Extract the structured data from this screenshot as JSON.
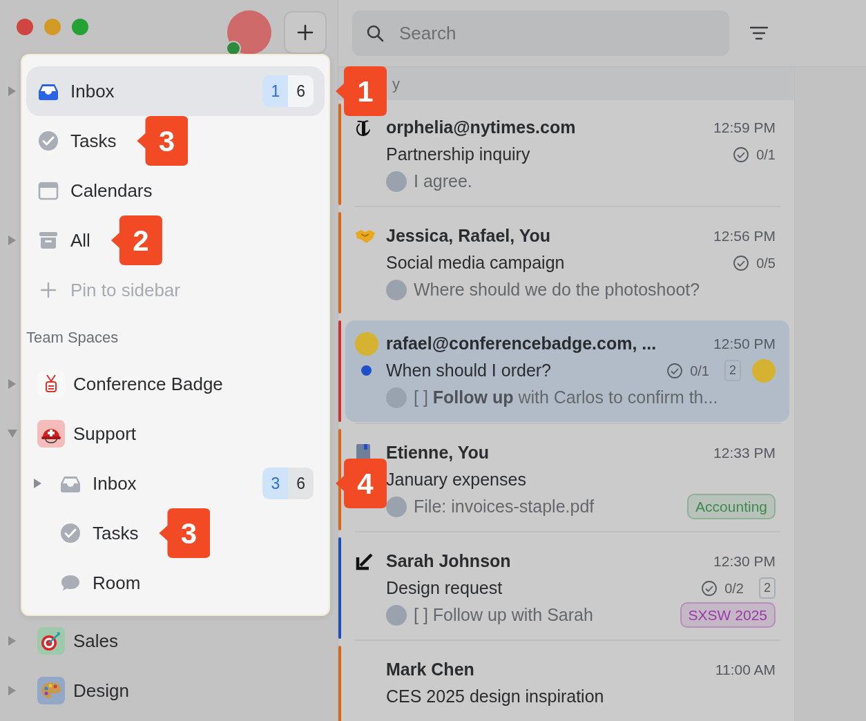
{
  "sidebar": {
    "pinned": [
      {
        "label": "Inbox",
        "kind": "inbox",
        "has_children": true,
        "expanded": false,
        "selected": true,
        "unread": "1",
        "total": "6",
        "callout": "1"
      },
      {
        "label": "Tasks",
        "kind": "tasks",
        "has_children": false,
        "selected": false,
        "callout": "3"
      },
      {
        "label": "Calendars",
        "kind": "calendar",
        "has_children": false,
        "selected": false
      },
      {
        "label": "All",
        "kind": "archive",
        "has_children": true,
        "expanded": false,
        "selected": false,
        "callout": "2"
      }
    ],
    "pin_action": "Pin to sidebar",
    "section_title": "Team Spaces",
    "spaces": [
      {
        "label": "Conference Badge",
        "kind": "badge",
        "has_children": true,
        "expanded": false,
        "spotlit": true
      },
      {
        "label": "Support",
        "kind": "helmet",
        "has_children": true,
        "expanded": true,
        "spotlit": true,
        "children": [
          {
            "label": "Inbox",
            "kind": "inbox",
            "has_children": true,
            "expanded": false,
            "unread": "3",
            "total": "6",
            "callout": "4"
          },
          {
            "label": "Tasks",
            "kind": "tasks",
            "has_children": false,
            "callout": "3"
          },
          {
            "label": "Room",
            "kind": "room",
            "has_children": false
          }
        ]
      },
      {
        "label": "Sales",
        "kind": "target",
        "has_children": true,
        "expanded": false,
        "spotlit": false
      },
      {
        "label": "Design",
        "kind": "palette",
        "has_children": true,
        "expanded": false,
        "spotlit": false
      }
    ]
  },
  "search": {
    "placeholder": "Search"
  },
  "list": {
    "section_header": "y",
    "messages": [
      {
        "color": "#d8671e",
        "kind": "newspaper",
        "sender": "orphelia@nytimes.com",
        "time": "12:59 PM",
        "unread": false,
        "selected": false,
        "subject": "Partnership inquiry",
        "tasks": "0/1",
        "preview": "I agree."
      },
      {
        "color": "#d8671e",
        "kind": "handshake",
        "sender": "Jessica, Rafael, You",
        "time": "12:56 PM",
        "unread": false,
        "selected": false,
        "subject": "Social media campaign",
        "tasks": "0/5",
        "preview": "Where should we do the photoshoot?"
      },
      {
        "color": "#c8332d",
        "kind": "person",
        "sender": "rafael@conferencebadge.com, ...",
        "time": "12:50 PM",
        "unread": true,
        "selected": true,
        "subject": "When should I order?",
        "tasks": "0/1",
        "count": "2",
        "preview": "[ ] **Follow up** with Carlos to confirm th..."
      },
      {
        "color": "#d8671e",
        "kind": "document",
        "sender": "Etienne, You",
        "time": "12:33 PM",
        "unread": false,
        "selected": false,
        "subject": "January expenses",
        "preview": "File: invoices-staple.pdf",
        "tag": {
          "label": "Accounting",
          "color": "#3d8a4c"
        }
      },
      {
        "color": "#1d4fb8",
        "kind": "forwarded",
        "sender": "Sarah Johnson",
        "time": "12:30 PM",
        "unread": false,
        "selected": false,
        "subject": "Design request",
        "tasks": "0/2",
        "count": "2",
        "preview": "[ ] Follow up with Sarah",
        "tag": {
          "label": "SXSW 2025",
          "color": "#9a3aa6"
        }
      },
      {
        "color": "#d8671e",
        "kind": "plain",
        "sender": "Mark Chen",
        "time": "11:00 AM",
        "unread": false,
        "selected": false,
        "subject": "CES 2025 design inspiration"
      }
    ]
  }
}
